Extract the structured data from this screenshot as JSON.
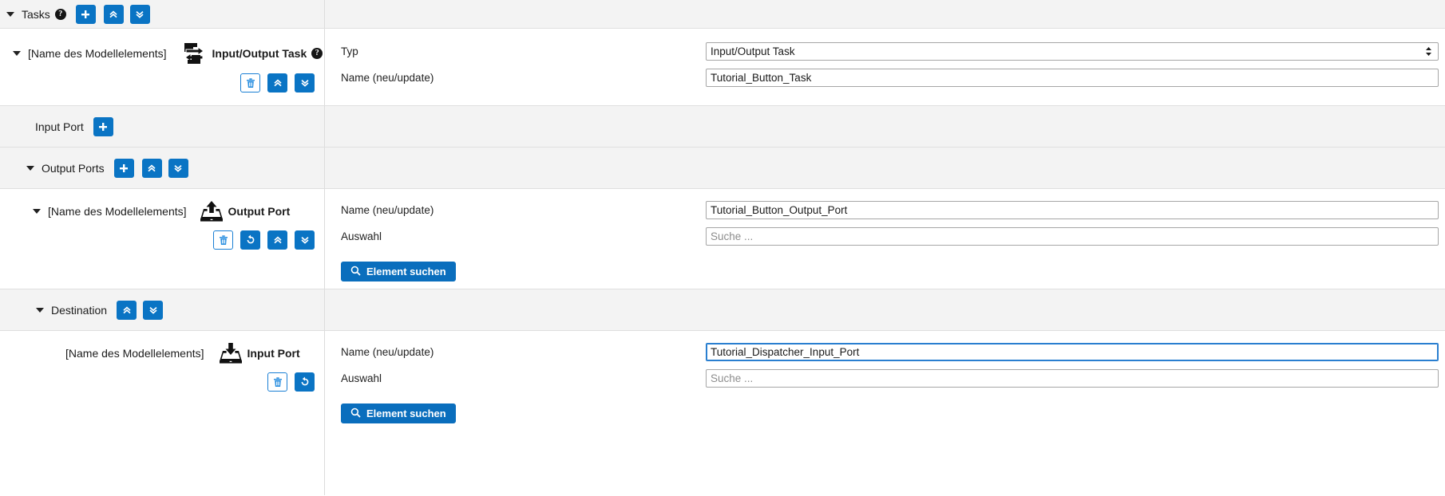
{
  "colors": {
    "accent": "#0a74c4",
    "accent_dark": "#0a6ebd",
    "band_grey": "#f3f3f3",
    "border": "#dcdcdc",
    "focus_blue": "#2a7fd0"
  },
  "header": {
    "title": "Tasks",
    "help_glyph": "?",
    "add_label": "+",
    "collapse_all_icon": "chevron-double-up-icon",
    "expand_all_icon": "chevron-double-down-icon"
  },
  "task": {
    "model_element_placeholder": "[Name des Modellelements]",
    "type_label": "Input/Output Task",
    "help_glyph": "?",
    "actions": {
      "delete_icon": "trash-icon",
      "move_up_icon": "chevron-double-up-icon",
      "move_down_icon": "chevron-double-down-icon"
    },
    "form": {
      "typ_label": "Typ",
      "typ_value": "Input/Output Task",
      "name_label": "Name (neu/update)",
      "name_value": "Tutorial_Button_Task"
    }
  },
  "input_port_section": {
    "label": "Input Port",
    "add_label": "+"
  },
  "output_ports_section": {
    "label": "Output Ports",
    "add_label": "+",
    "collapse_all_icon": "chevron-double-up-icon",
    "expand_all_icon": "chevron-double-down-icon"
  },
  "output_port": {
    "model_element_placeholder": "[Name des Modellelements]",
    "type_label": "Output Port",
    "icon": "export-tray-icon",
    "actions": {
      "delete_icon": "trash-icon",
      "reset_icon": "refresh-ccw-icon",
      "move_up_icon": "chevron-double-up-icon",
      "move_down_icon": "chevron-double-down-icon"
    },
    "form": {
      "name_label": "Name (neu/update)",
      "name_value": "Tutorial_Button_Output_Port",
      "auswahl_label": "Auswahl",
      "auswahl_value": "",
      "auswahl_placeholder": "Suche ...",
      "search_button_label": "Element suchen",
      "search_button_icon": "search-icon"
    }
  },
  "destination_section": {
    "label": "Destination",
    "collapse_all_icon": "chevron-double-up-icon",
    "expand_all_icon": "chevron-double-down-icon"
  },
  "destination_port": {
    "model_element_placeholder": "[Name des Modellelements]",
    "type_label": "Input Port",
    "icon": "import-tray-icon",
    "actions": {
      "delete_icon": "trash-icon",
      "reset_icon": "refresh-ccw-icon"
    },
    "form": {
      "name_label": "Name (neu/update)",
      "name_value": "Tutorial_Dispatcher_Input_Port",
      "name_focused": true,
      "auswahl_label": "Auswahl",
      "auswahl_value": "",
      "auswahl_placeholder": "Suche ...",
      "search_button_label": "Element suchen",
      "search_button_icon": "search-icon"
    }
  }
}
